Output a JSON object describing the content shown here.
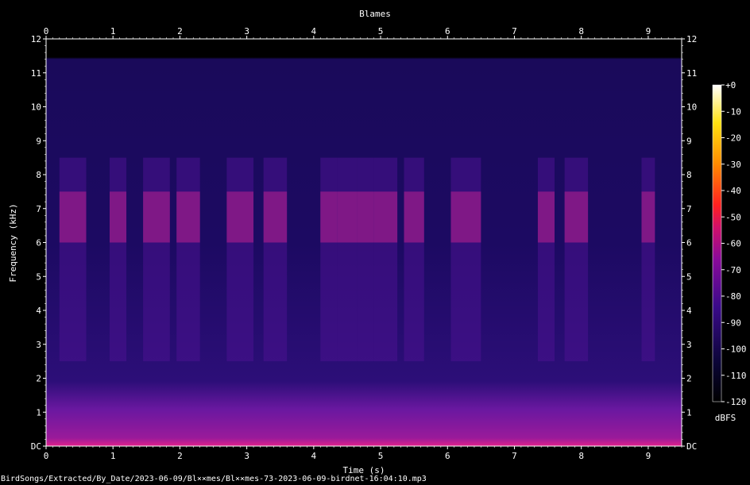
{
  "chart_data": {
    "type": "heatmap",
    "title": "Blames",
    "xlabel": "Time (s)",
    "ylabel": "Frequency (kHz)",
    "xlim": [
      0,
      9.5
    ],
    "ylim": [
      0,
      12
    ],
    "x_ticks": [
      "0",
      "1",
      "2",
      "3",
      "4",
      "5",
      "6",
      "7",
      "8",
      "9"
    ],
    "y_ticks": [
      "DC",
      "1",
      "2",
      "3",
      "4",
      "5",
      "6",
      "7",
      "8",
      "9",
      "10",
      "11",
      "12"
    ],
    "colorbar": {
      "unit": "dBFS",
      "range": [
        -120,
        0
      ],
      "ticks": [
        "+0",
        "-10",
        "-20",
        "-30",
        "-40",
        "-50",
        "-60",
        "-70",
        "-80",
        "-90",
        "-100",
        "-110",
        "-120"
      ]
    },
    "colors": {
      "background": "#000000",
      "noise_floor": "#1a0a5a",
      "mid": "#8a1a9a",
      "hot": "#ff2a40"
    },
    "energy_bursts_s": [
      [
        0.2,
        0.6
      ],
      [
        0.95,
        1.2
      ],
      [
        1.45,
        1.85
      ],
      [
        1.95,
        2.3
      ],
      [
        2.7,
        3.1
      ],
      [
        3.25,
        3.6
      ],
      [
        4.1,
        4.35
      ],
      [
        4.35,
        4.65
      ],
      [
        4.65,
        4.9
      ],
      [
        4.9,
        5.25
      ],
      [
        5.35,
        5.65
      ],
      [
        6.05,
        6.5
      ],
      [
        7.35,
        7.6
      ],
      [
        7.75,
        8.1
      ],
      [
        8.9,
        9.1
      ]
    ],
    "burst_band_khz": [
      2.5,
      8.5
    ],
    "strong_band_khz": [
      6.0,
      7.5
    ]
  },
  "footer": {
    "file_path": "BirdSongs/Extracted/By_Date/2023-06-09/Bl××mes/Bl××mes-73-2023-06-09-birdnet-16:04:10.mp3"
  }
}
